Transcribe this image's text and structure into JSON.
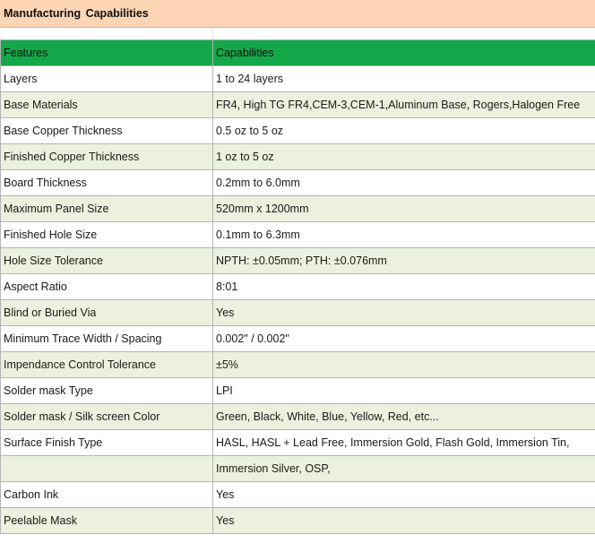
{
  "title": "Manufacturing  Capabilities",
  "colors": {
    "title_bg": "#fcd5b4",
    "header_bg": "#15a84a",
    "alt_row_bg": "#ebf1de"
  },
  "header": {
    "features": "Features",
    "capabilities": "Capabilities"
  },
  "rows": [
    {
      "feature": "Layers",
      "capability": "1  to  24 layers"
    },
    {
      "feature": "Base Materials",
      "capability": "FR4, High TG FR4,CEM-3,CEM-1,Aluminum Base, Rogers,Halogen Free"
    },
    {
      "feature": "Base Copper Thickness",
      "capability": "0.5 oz to 5 oz"
    },
    {
      "feature": "Finished Copper Thickness",
      "capability": "1 oz to 5 oz"
    },
    {
      "feature": "Board Thickness",
      "capability": "0.2mm to 6.0mm"
    },
    {
      "feature": "Maximum Panel Size",
      "capability": "520mm x 1200mm"
    },
    {
      "feature": "Finished Hole Size",
      "capability": "0.1mm to 6.3mm"
    },
    {
      "feature": "Hole Size Tolerance",
      "capability": "NPTH: ±0.05mm; PTH: ±0.076mm"
    },
    {
      "feature": "Aspect  Ratio",
      "capability": "8:01"
    },
    {
      "feature": "Blind  or  Buried  Via",
      "capability": "Yes"
    },
    {
      "feature": "Minimum  Trace  Width / Spacing",
      "capability": "0.002\" / 0.002\""
    },
    {
      "feature": "Impendance Control Tolerance",
      "capability": "±5%"
    },
    {
      "feature": "Solder mask Type",
      "capability": "LPI"
    },
    {
      "feature": "Solder mask / Silk screen Color",
      "capability": "Green, Black, White, Blue, Yellow, Red, etc..."
    },
    {
      "feature": "Surface Finish Type",
      "capability": "HASL, HASL + Lead Free, Immersion Gold, Flash Gold, Immersion Tin,"
    },
    {
      "feature": "",
      "capability": "Immersion Silver, OSP,"
    },
    {
      "feature": "Carbon Ink",
      "capability": "Yes"
    },
    {
      "feature": "Peelable Mask",
      "capability": "Yes"
    }
  ]
}
